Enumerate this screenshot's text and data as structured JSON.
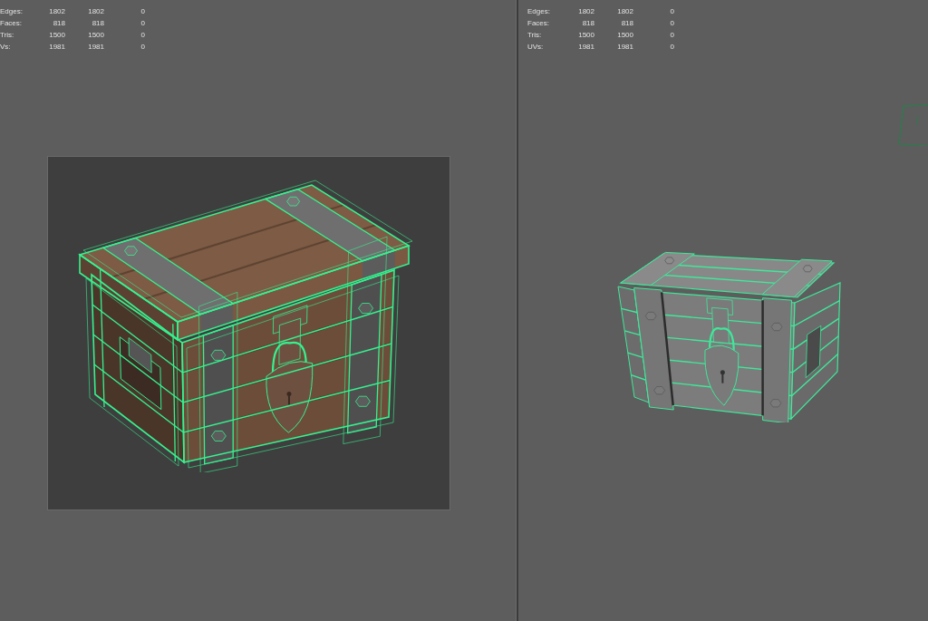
{
  "viewports": [
    {
      "kind": "reference_image",
      "stats": [
        {
          "label": "Edges:",
          "values": [
            "1802",
            "1802",
            "0"
          ]
        },
        {
          "label": "Faces:",
          "values": [
            "818",
            "818",
            "0"
          ]
        },
        {
          "label": "Tris:",
          "values": [
            "1500",
            "1500",
            "0"
          ]
        },
        {
          "label": "Vs:",
          "values": [
            "1981",
            "1981",
            "0"
          ]
        }
      ]
    },
    {
      "kind": "shaded_model",
      "stats": [
        {
          "label": "Edges:",
          "values": [
            "1802",
            "1802",
            "0"
          ]
        },
        {
          "label": "Faces:",
          "values": [
            "818",
            "818",
            "0"
          ]
        },
        {
          "label": "Tris:",
          "values": [
            "1500",
            "1500",
            "0"
          ]
        },
        {
          "label": "UVs:",
          "values": [
            "1981",
            "1981",
            "0"
          ]
        }
      ]
    }
  ]
}
